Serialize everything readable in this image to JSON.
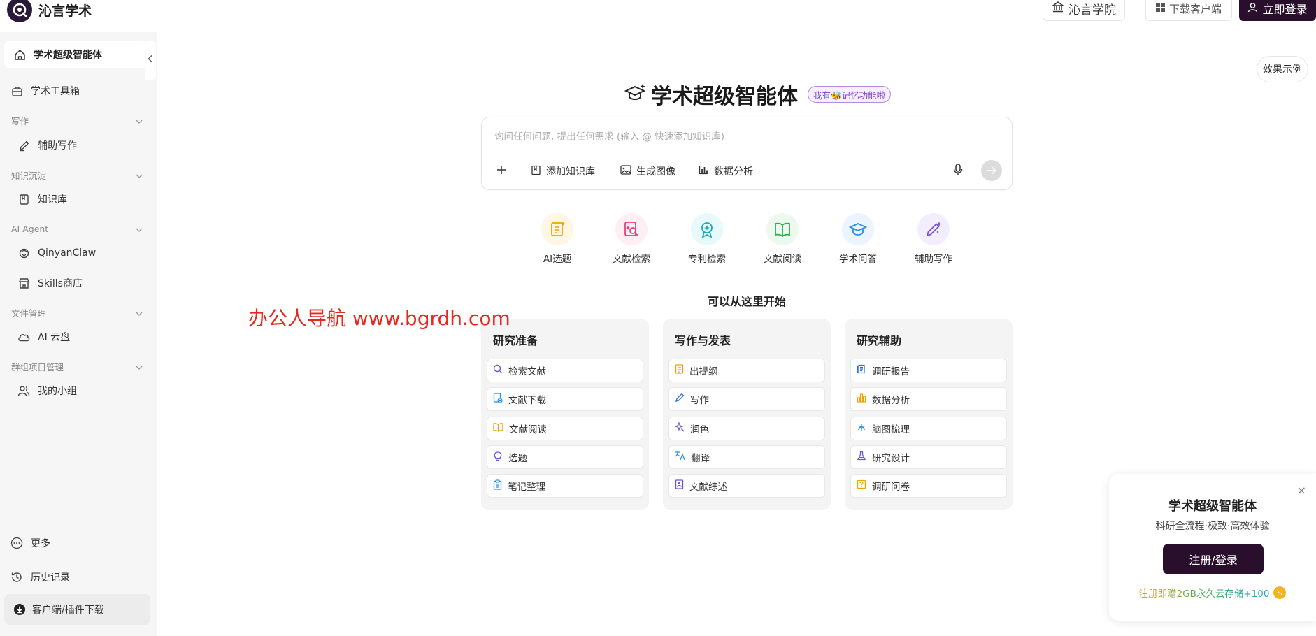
{
  "header": {
    "brand": "沁言学术",
    "academy_label": "沁言学院",
    "download_label": "下载客户端",
    "login_label": "立即登录"
  },
  "sidebar": {
    "active_item": "学术超级智能体",
    "toolbox": "学术工具箱",
    "sections": [
      {
        "title": "写作",
        "items": [
          "辅助写作"
        ]
      },
      {
        "title": "知识沉淀",
        "items": [
          "知识库"
        ]
      },
      {
        "title": "AI Agent",
        "items": [
          "QinyanClaw",
          "Skills商店"
        ]
      },
      {
        "title": "文件管理",
        "items": [
          "AI 云盘"
        ]
      },
      {
        "title": "群组项目管理",
        "items": [
          "我的小组"
        ]
      }
    ],
    "more": "更多",
    "history": "历史记录",
    "client_download": "客户端/插件下载"
  },
  "main": {
    "title": "学术超级智能体",
    "memory_badge": "我有🐝记忆功能啦",
    "effect_example": "效果示例",
    "input_placeholder": "询问任何问题, 提出任何需求 (输入 @ 快速添加知识库)",
    "tools": [
      "添加知识库",
      "生成图像",
      "数据分析"
    ],
    "quick_actions": [
      {
        "label": "AI选题",
        "icon": "topic-icon",
        "color": "#f2a200",
        "bg": "#fff7e6"
      },
      {
        "label": "文献检索",
        "icon": "doc-search-icon",
        "color": "#e8407a",
        "bg": "#fff0f5"
      },
      {
        "label": "专利检索",
        "icon": "patent-icon",
        "color": "#1aa8b8",
        "bg": "#eafafb"
      },
      {
        "label": "文献阅读",
        "icon": "book-icon",
        "color": "#2bb04a",
        "bg": "#eefaf0"
      },
      {
        "label": "学术问答",
        "icon": "grad-cap-icon",
        "color": "#2a8fe0",
        "bg": "#eef6ff"
      },
      {
        "label": "辅助写作",
        "icon": "magic-pen-icon",
        "color": "#7a4fe0",
        "bg": "#f4efff"
      }
    ],
    "start_title": "可以从这里开始",
    "cards": [
      {
        "title": "研究准备",
        "items": [
          "检索文献",
          "文献下载",
          "文献阅读",
          "选题",
          "笔记整理"
        ]
      },
      {
        "title": "写作与发表",
        "items": [
          "出提纲",
          "写作",
          "润色",
          "翻译",
          "文献综述"
        ]
      },
      {
        "title": "研究辅助",
        "items": [
          "调研报告",
          "数据分析",
          "脑图梳理",
          "研究设计",
          "调研问卷"
        ]
      }
    ]
  },
  "watermark": "办公人导航 www.bgrdh.com",
  "promo": {
    "title": "学术超级智能体",
    "subtitle": "科研全流程·极致·高效体验",
    "button": "注册/登录",
    "gift": "注册即赠2GB永久云存储+100",
    "close": "×",
    "coin": "$"
  }
}
